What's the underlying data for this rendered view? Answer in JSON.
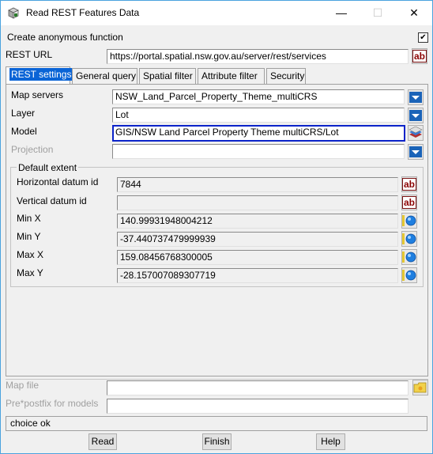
{
  "window": {
    "title": "Read REST Features Data",
    "minimize": "—",
    "maximize": "☐",
    "close": "✕"
  },
  "options": {
    "anon_label": "Create anonymous function",
    "anon_checked": true
  },
  "rest_url": {
    "label": "REST URL",
    "value": "https://portal.spatial.nsw.gov.au/server/rest/services"
  },
  "tabs": [
    {
      "label": "REST settings",
      "active": true
    },
    {
      "label": "General query"
    },
    {
      "label": "Spatial filter"
    },
    {
      "label": "Attribute filter"
    },
    {
      "label": "Security"
    }
  ],
  "rest": {
    "map_servers": {
      "label": "Map servers",
      "value": "NSW_Land_Parcel_Property_Theme_multiCRS"
    },
    "layer": {
      "label": "Layer",
      "value": "Lot"
    },
    "model": {
      "label": "Model",
      "value": "GIS/NSW Land Parcel Property Theme multiCRS/Lot"
    },
    "projection": {
      "label": "Projection",
      "value": ""
    }
  },
  "extent": {
    "title": "Default extent",
    "horizontal_datum": {
      "label": "Horizontal datum id",
      "value": "7844"
    },
    "vertical_datum": {
      "label": "Vertical datum id",
      "value": ""
    },
    "min_x": {
      "label": "Min X",
      "value": "140.99931948004212"
    },
    "min_y": {
      "label": "Min Y",
      "value": "-37.440737479999939"
    },
    "max_x": {
      "label": "Max X",
      "value": "159.08456768300005"
    },
    "max_y": {
      "label": "Max Y",
      "value": "-28.157007089307719"
    }
  },
  "bottom": {
    "map_file": {
      "label": "Map file",
      "value": ""
    },
    "prefix": {
      "label": "Pre*postfix for models",
      "value": ""
    }
  },
  "status": "choice ok",
  "buttons": {
    "read": "Read",
    "finish": "Finish",
    "help": "Help"
  },
  "icons": {
    "ab": "ab",
    "checkbox_mark": "✔"
  },
  "colors": {
    "accent": "#0a64d6",
    "focus_border": "#0b23c9",
    "ab_red": "#8b0000",
    "dropdown_blue": "#1a63b8"
  }
}
